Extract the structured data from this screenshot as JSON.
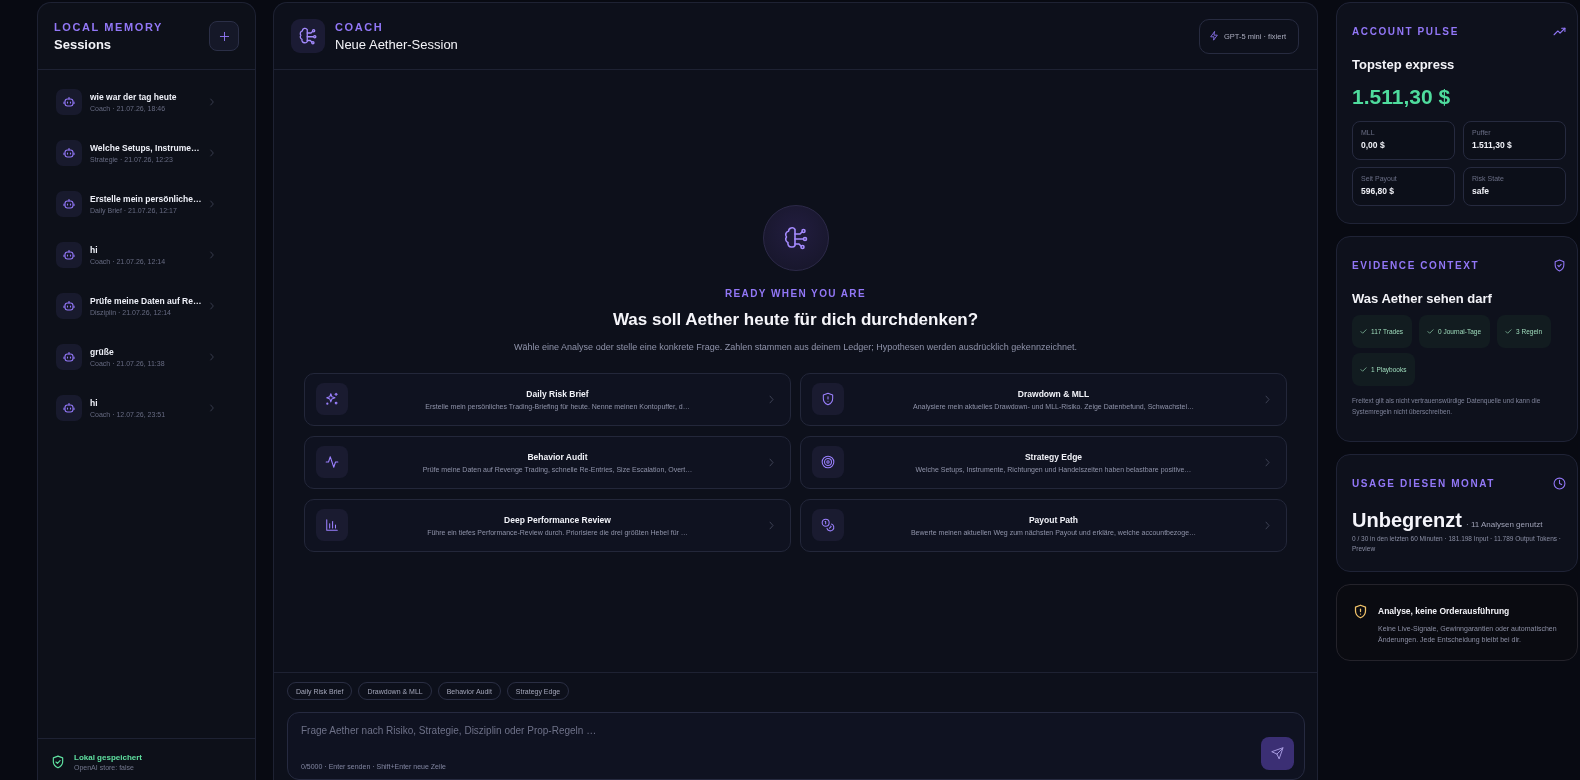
{
  "sidebar": {
    "eyebrow": "LOCAL MEMORY",
    "title": "Sessions",
    "sessions": [
      {
        "title": "wie war der tag heute",
        "meta": "Coach · 21.07.26, 18:46"
      },
      {
        "title": "Welche Setups, Instrume…",
        "meta": "Strategie · 21.07.26, 12:23"
      },
      {
        "title": "Erstelle mein persönliche…",
        "meta": "Daily Brief · 21.07.26, 12:17"
      },
      {
        "title": "hi",
        "meta": "Coach · 21.07.26, 12:14"
      },
      {
        "title": "Prüfe meine Daten auf Re…",
        "meta": "Disziplin · 21.07.26, 12:14"
      },
      {
        "title": "grüße",
        "meta": "Coach · 21.07.26, 11:38"
      },
      {
        "title": "hi",
        "meta": "Coach · 12.07.26, 23:51"
      }
    ],
    "footer": {
      "title": "Lokal gespeichert",
      "subtitle": "OpenAI store: false"
    }
  },
  "chat": {
    "eyebrow": "COACH",
    "title": "Neue Aether-Session",
    "model_badge": "GPT-5 mini · fixiert",
    "empty_state": {
      "eyebrow": "READY WHEN YOU ARE",
      "heading": "Was soll Aether heute für dich durchdenken?",
      "subtitle": "Wähle eine Analyse oder stelle eine konkrete Frage. Zahlen stammen aus deinem Ledger; Hypothesen werden ausdrücklich gekennzeichnet."
    },
    "prompt_cards": [
      {
        "kind": "sparkle",
        "title": "Daily Risk Brief",
        "description": "Erstelle mein persönliches Trading-Briefing für heute. Nenne meinen Kontopuffer, d…"
      },
      {
        "kind": "shield",
        "title": "Drawdown & MLL",
        "description": "Analysiere mein aktuelles Drawdown- und MLL-Risiko. Zeige Datenbefund, Schwachstel…"
      },
      {
        "kind": "pulse",
        "title": "Behavior Audit",
        "description": "Prüfe meine Daten auf Revenge Trading, schnelle Re-Entries, Size Escalation, Overt…"
      },
      {
        "kind": "target",
        "title": "Strategy Edge",
        "description": "Welche Setups, Instrumente, Richtungen und Handelszeiten haben belastbare positive…"
      },
      {
        "kind": "chart",
        "title": "Deep Performance Review",
        "description": "Führe ein tiefes Performance-Review durch. Priorisiere die drei größten Hebel für …"
      },
      {
        "kind": "coins",
        "title": "Payout Path",
        "description": "Bewerte meinen aktuellen Weg zum nächsten Payout und erkläre, welche accountbezoge…"
      }
    ],
    "quick_prompts": [
      "Daily Risk Brief",
      "Drawdown & MLL",
      "Behavior Audit",
      "Strategy Edge"
    ],
    "composer": {
      "placeholder": "Frage Aether nach Risiko, Strategie, Disziplin oder Prop-Regeln …",
      "hint": "0/5000 · Enter senden · Shift+Enter neue Zeile"
    }
  },
  "account_pulse": {
    "eyebrow": "ACCOUNT PULSE",
    "account": "Topstep express",
    "balance": "1.511,30 $",
    "stats": [
      {
        "label": "MLL",
        "value": "0,00 $"
      },
      {
        "label": "Puffer",
        "value": "1.511,30 $"
      },
      {
        "label": "Seit Payout",
        "value": "596,80 $"
      },
      {
        "label": "Risk State",
        "value": "safe"
      }
    ]
  },
  "evidence_context": {
    "eyebrow": "EVIDENCE CONTEXT",
    "title": "Was Aether sehen darf",
    "tags": [
      "117 Trades",
      "0 Journal-Tage",
      "3 Regeln",
      "1 Playbooks"
    ],
    "note": "Freitext gilt als nicht vertrauenswürdige Datenquelle und kann die Systemregeln nicht überschreiben."
  },
  "usage": {
    "eyebrow": "USAGE DIESEN MONAT",
    "value": "Unbegrenzt",
    "count": "· 11 Analysen genutzt",
    "detail": "0 / 30 in den letzten 60 Minuten · 181.198 Input · 11.789 Output Tokens · Preview"
  },
  "notice": {
    "title": "Analyse, keine Orderausführung",
    "text": "Keine Live-Signale, Gewinngarantien oder automatischen Änderungen. Jede Entscheidung bleibt bei dir."
  }
}
